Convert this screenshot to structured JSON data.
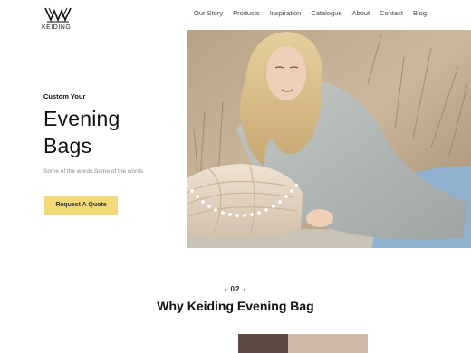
{
  "brand": {
    "name": "KEIDING"
  },
  "nav": {
    "items": [
      "Our Story",
      "Products",
      "Inspiration",
      "Catalogue",
      "About",
      "Contact",
      "Blog"
    ]
  },
  "hero": {
    "eyebrow": "Custom Your",
    "title_line1": "Evening",
    "title_line2": "Bags",
    "subtitle": "Some of the words Some of the words",
    "cta_label": "Request A Quote"
  },
  "section": {
    "number": "- 02 -",
    "title": "Why Keiding Evening Bag"
  },
  "colors": {
    "accent": "#f3d977",
    "text": "#111111",
    "muted": "#888888"
  }
}
